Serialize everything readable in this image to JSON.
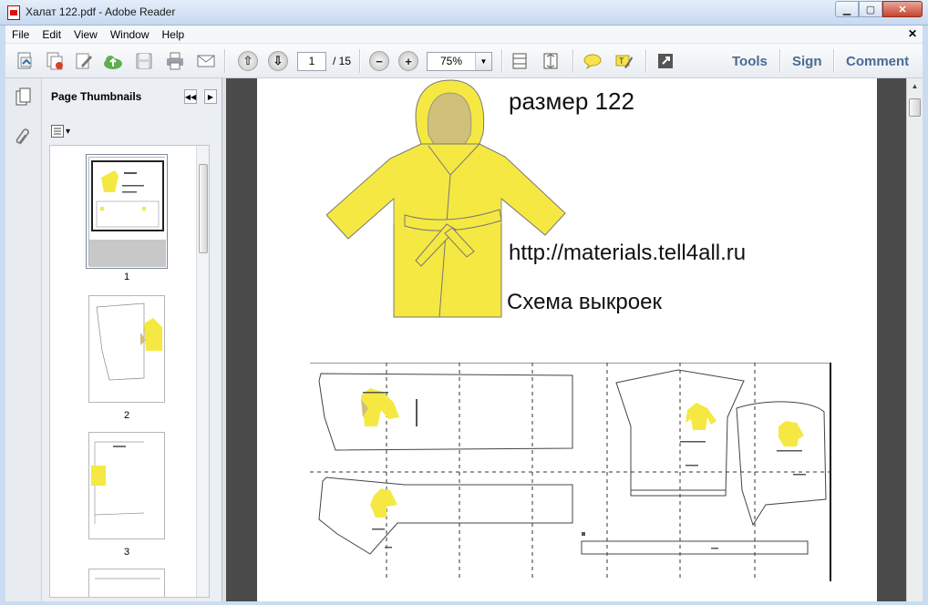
{
  "window": {
    "title": "Халат 122.pdf - Adobe Reader",
    "minimize": "▁",
    "maximize": "▢",
    "close": "✕"
  },
  "menu": {
    "items": [
      "File",
      "Edit",
      "View",
      "Window",
      "Help"
    ],
    "close": "✕"
  },
  "toolbar": {
    "page_current": "1",
    "page_total": "/ 15",
    "zoom": "75%",
    "zoom_arrow": "▼",
    "tools": "Tools",
    "sign": "Sign",
    "comment": "Comment",
    "icons": [
      "create-pdf-icon",
      "combine-icon",
      "edit-icon",
      "cloud-upload-icon",
      "save-icon",
      "print-icon",
      "email-icon",
      "prev-page-icon",
      "next-page-icon",
      "zoom-out-icon",
      "zoom-in-icon",
      "fit-page-icon",
      "scroll-mode-icon",
      "comment-note-icon",
      "highlight-icon",
      "fullscreen-icon"
    ]
  },
  "panel": {
    "header": "Page Thumbnails",
    "collapse": "◀◀",
    "expand": "▶",
    "options_arrow": "▾",
    "thumbnails": [
      {
        "label": "1",
        "selected": true
      },
      {
        "label": "2",
        "selected": false
      },
      {
        "label": "3",
        "selected": false
      }
    ]
  },
  "document": {
    "size_title": "размер 122",
    "url": "http://materials.tell4all.ru",
    "scheme_title": "Схема выкроек",
    "accent_color": "#f5e842",
    "hood_inner_color": "#cfc07a"
  }
}
